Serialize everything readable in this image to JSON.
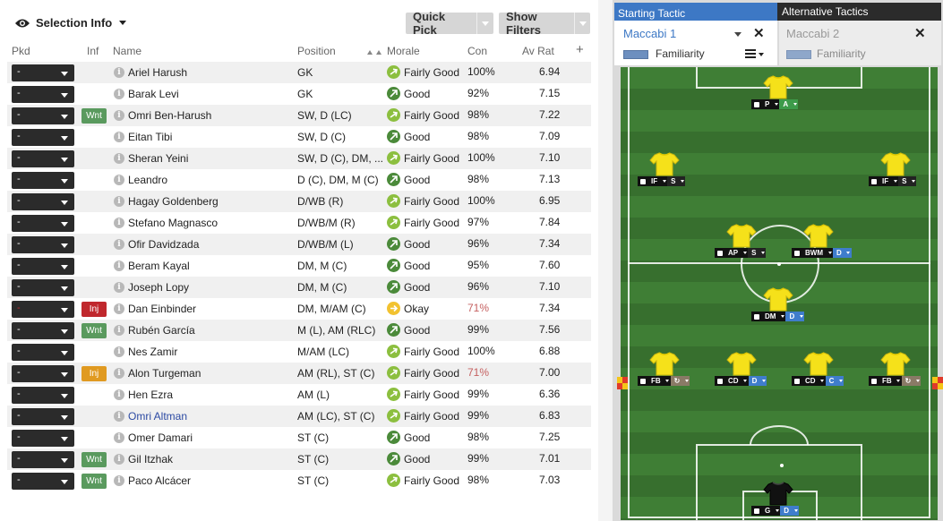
{
  "toolbar": {
    "selection_info": "Selection Info",
    "quick_pick": "Quick Pick",
    "show_filters": "Show Filters"
  },
  "columns": {
    "pkd": "Pkd",
    "inf": "Inf",
    "name": "Name",
    "position": "Position",
    "morale": "Morale",
    "con": "Con",
    "av_rat": "Av Rat",
    "add": "+"
  },
  "players": [
    {
      "pkd": "-",
      "inf": "",
      "name": "Ariel Harush",
      "position": "GK",
      "morale": "Fairly Good",
      "con": "100%",
      "av_rat": "6.94"
    },
    {
      "pkd": "-",
      "inf": "",
      "name": "Barak Levi",
      "position": "GK",
      "morale": "Good",
      "con": "92%",
      "av_rat": "7.15"
    },
    {
      "pkd": "-",
      "inf": "Wnt",
      "name": "Omri Ben-Harush",
      "position": "SW, D (LC)",
      "morale": "Fairly Good",
      "con": "98%",
      "av_rat": "7.22"
    },
    {
      "pkd": "-",
      "inf": "",
      "name": "Eitan Tibi",
      "position": "SW, D (C)",
      "morale": "Good",
      "con": "98%",
      "av_rat": "7.09"
    },
    {
      "pkd": "-",
      "inf": "",
      "name": "Sheran Yeini",
      "position": "SW, D (C), DM, ...",
      "morale": "Fairly Good",
      "con": "100%",
      "av_rat": "7.10"
    },
    {
      "pkd": "-",
      "inf": "",
      "name": "Leandro",
      "position": "D (C), DM, M (C)",
      "morale": "Good",
      "con": "98%",
      "av_rat": "7.13"
    },
    {
      "pkd": "-",
      "inf": "",
      "name": "Hagay Goldenberg",
      "position": "D/WB (R)",
      "morale": "Fairly Good",
      "con": "100%",
      "av_rat": "6.95"
    },
    {
      "pkd": "-",
      "inf": "",
      "name": "Stefano Magnasco",
      "position": "D/WB/M (R)",
      "morale": "Fairly Good",
      "con": "97%",
      "av_rat": "7.84"
    },
    {
      "pkd": "-",
      "inf": "",
      "name": "Ofir Davidzada",
      "position": "D/WB/M (L)",
      "morale": "Good",
      "con": "96%",
      "av_rat": "7.34"
    },
    {
      "pkd": "-",
      "inf": "",
      "name": "Beram Kayal",
      "position": "DM, M (C)",
      "morale": "Good",
      "con": "95%",
      "av_rat": "7.60"
    },
    {
      "pkd": "-",
      "inf": "",
      "name": "Joseph Lopy",
      "position": "DM, M (C)",
      "morale": "Good",
      "con": "96%",
      "av_rat": "7.10"
    },
    {
      "pkd": "-",
      "inf": "Inj",
      "name": "Dan Einbinder",
      "position": "DM, M/AM (C)",
      "morale": "Okay",
      "con": "71%",
      "av_rat": "7.34"
    },
    {
      "pkd": "-",
      "inf": "Wnt",
      "name": "Rubén García",
      "position": "M (L), AM (RLC)",
      "morale": "Good",
      "con": "99%",
      "av_rat": "7.56"
    },
    {
      "pkd": "-",
      "inf": "",
      "name": "Nes Zamir",
      "position": "M/AM (LC)",
      "morale": "Fairly Good",
      "con": "100%",
      "av_rat": "6.88"
    },
    {
      "pkd": "-",
      "inf": "Inj",
      "name": "Alon Turgeman",
      "position": "AM (RL), ST (C)",
      "morale": "Fairly Good",
      "con": "71%",
      "av_rat": "7.00"
    },
    {
      "pkd": "-",
      "inf": "",
      "name": "Hen Ezra",
      "position": "AM (L)",
      "morale": "Fairly Good",
      "con": "99%",
      "av_rat": "6.36"
    },
    {
      "pkd": "-",
      "inf": "",
      "name": "Omri Altman",
      "position": "AM (LC), ST (C)",
      "morale": "Fairly Good",
      "con": "99%",
      "av_rat": "6.83"
    },
    {
      "pkd": "-",
      "inf": "",
      "name": "Omer Damari",
      "position": "ST (C)",
      "morale": "Good",
      "con": "98%",
      "av_rat": "7.25"
    },
    {
      "pkd": "-",
      "inf": "Wnt",
      "name": "Gil Itzhak",
      "position": "ST (C)",
      "morale": "Good",
      "con": "99%",
      "av_rat": "7.01"
    },
    {
      "pkd": "-",
      "inf": "Wnt",
      "name": "Paco Alcácer",
      "position": "ST (C)",
      "morale": "Fairly Good",
      "con": "98%",
      "av_rat": "7.03"
    }
  ],
  "tactics": {
    "starting_tab": "Starting Tactic",
    "alternative_tab": "Alternative Tactics",
    "starting_name": "Maccabi 1",
    "alternative_name": "Maccabi 2",
    "familiarity": "Familiarity",
    "close": "✕"
  },
  "pitch_players": [
    {
      "role": "P",
      "duty": "A",
      "duty_color": "green"
    },
    {
      "role": "IF",
      "duty": "S",
      "duty_color": "black"
    },
    {
      "role": "IF",
      "duty": "S",
      "duty_color": "black"
    },
    {
      "role": "AP",
      "duty": "S",
      "duty_color": "black"
    },
    {
      "role": "BWM",
      "duty": "D",
      "duty_color": "blue"
    },
    {
      "role": "DM",
      "duty": "D",
      "duty_color": "blue"
    },
    {
      "role": "FB",
      "duty": "↻",
      "duty_color": "grey"
    },
    {
      "role": "CD",
      "duty": "D",
      "duty_color": "blue"
    },
    {
      "role": "CD",
      "duty": "C",
      "duty_color": "blue"
    },
    {
      "role": "FB",
      "duty": "↻",
      "duty_color": "grey"
    },
    {
      "role": "G",
      "duty": "D",
      "duty_color": "blue"
    }
  ],
  "colors": {
    "accent": "#3d78c5",
    "pitch": "#3d7a33",
    "shirt": "#f5e11a",
    "wanted": "#5a9a5e",
    "injured_red": "#c0282d",
    "injured_orange": "#e09a21",
    "morale_good": "#4b8a3a",
    "morale_fairly_good": "#8cbf3f",
    "morale_okay": "#f2c230"
  },
  "icons": {
    "selection": "eye-icon",
    "info": "info-icon",
    "morale": "arrow-icon",
    "familiarity": "familiarity-bar",
    "menu": "menu-icon"
  }
}
